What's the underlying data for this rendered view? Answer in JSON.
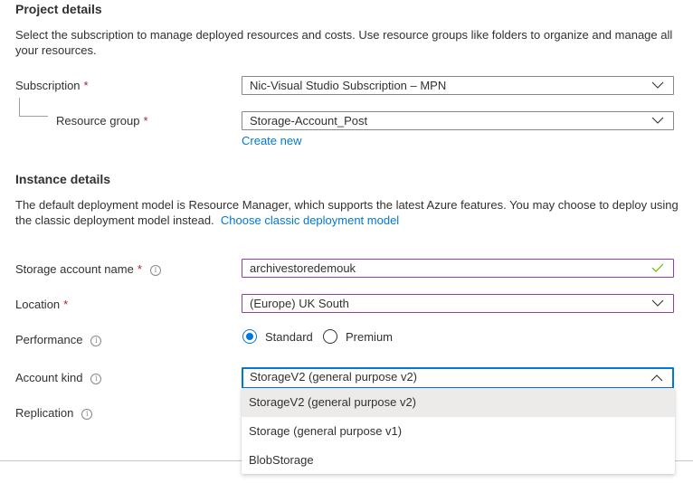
{
  "project_details": {
    "heading": "Project details",
    "description_line1": "Select the subscription to manage deployed resources and costs. Use resource groups like folders to organize and manage all",
    "description_line2": "your resources.",
    "subscription": {
      "label": "Subscription",
      "required_mark": "*",
      "value": "Nic-Visual Studio Subscription – MPN"
    },
    "resource_group": {
      "label": "Resource group",
      "required_mark": "*",
      "value": "Storage-Account_Post",
      "create_new_link": "Create new"
    }
  },
  "instance_details": {
    "heading": "Instance details",
    "description_line1": "The default deployment model is Resource Manager, which supports the latest Azure features. You may choose to deploy using",
    "description_line2": "the classic deployment model instead.",
    "classic_link": "Choose classic deployment model",
    "storage_account_name": {
      "label": "Storage account name",
      "required_mark": "*",
      "info_icon": "i",
      "value": "archivestoredemouk",
      "valid_icon": "checkmark-icon"
    },
    "location": {
      "label": "Location",
      "required_mark": "*",
      "value": "(Europe) UK South"
    },
    "performance": {
      "label": "Performance",
      "info_icon": "i",
      "options": [
        {
          "label": "Standard",
          "checked": true
        },
        {
          "label": "Premium",
          "checked": false
        }
      ]
    },
    "account_kind": {
      "label": "Account kind",
      "info_icon": "i",
      "value": "StorageV2 (general purpose v2)",
      "expanded": true,
      "options": [
        {
          "label": "StorageV2 (general purpose v2)",
          "selected": true
        },
        {
          "label": "Storage (general purpose v1)",
          "selected": false
        },
        {
          "label": "BlobStorage",
          "selected": false
        }
      ]
    },
    "replication": {
      "label": "Replication",
      "info_icon": "i"
    }
  },
  "colors": {
    "accent": "#0078d4",
    "required": "#a4262c",
    "valid_check": "#6bb700",
    "active_border": "#8c3fa4",
    "option_selected_bg": "#edebe9"
  }
}
